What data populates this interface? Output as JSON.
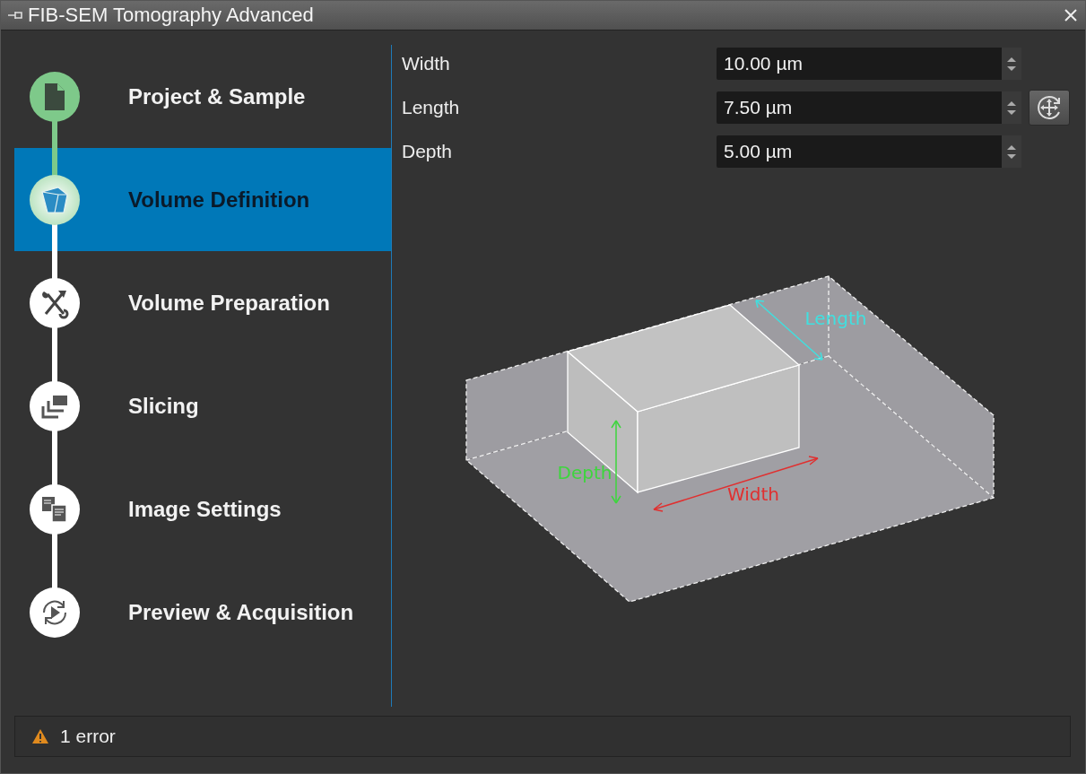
{
  "window": {
    "title": "FIB-SEM Tomography Advanced"
  },
  "steps": [
    {
      "label": "Project & Sample",
      "kind": "document",
      "selected": false,
      "completed": true
    },
    {
      "label": "Volume Definition",
      "kind": "cube",
      "selected": true,
      "completed": true
    },
    {
      "label": "Volume Preparation",
      "kind": "tools",
      "selected": false,
      "completed": false
    },
    {
      "label": "Slicing",
      "kind": "slices",
      "selected": false,
      "completed": false
    },
    {
      "label": "Image Settings",
      "kind": "images",
      "selected": false,
      "completed": false
    },
    {
      "label": "Preview & Acquisition",
      "kind": "acquire",
      "selected": false,
      "completed": false
    }
  ],
  "fields": [
    {
      "label": "Width",
      "value": "10.00 µm",
      "has_button": false
    },
    {
      "label": "Length",
      "value": "7.50 µm",
      "has_button": true
    },
    {
      "label": "Depth",
      "value": "5.00 µm",
      "has_button": false
    }
  ],
  "diagram": {
    "labels": [
      {
        "text": "Length",
        "color": "#40e0e0"
      },
      {
        "text": "Depth",
        "color": "#3dd63d"
      },
      {
        "text": "Width",
        "color": "#e03030"
      }
    ]
  },
  "status_bar": {
    "text": "1 error"
  }
}
